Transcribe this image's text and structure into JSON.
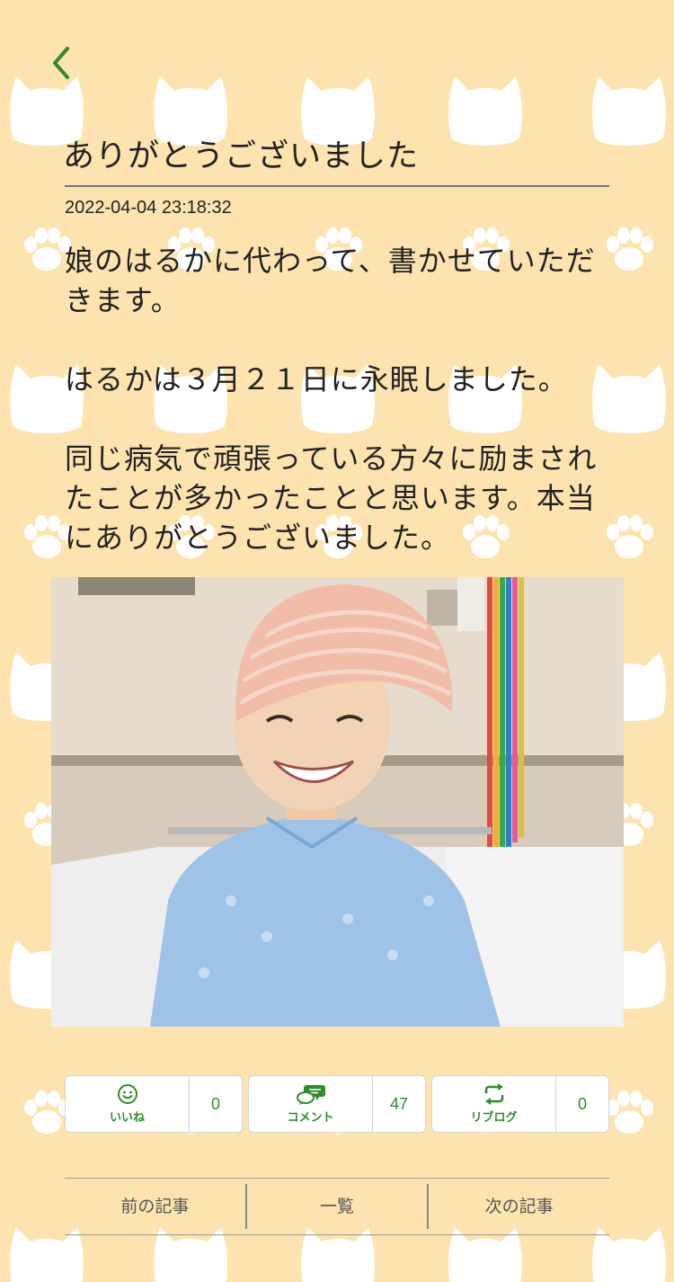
{
  "header": {
    "back_icon": "chevron-left-icon"
  },
  "post": {
    "title": "ありがとうございました",
    "date": "2022-04-04 23:18:32",
    "paragraphs": [
      "娘のはるかに代わって、書かせていただきます。",
      "はるかは３月２１日に永眠しました。",
      "同じ病気で頑張っている方々に励まされたことが多かったことと思います。本当にありがとうございました。"
    ]
  },
  "actions": {
    "like": {
      "label": "いいね",
      "count": "0",
      "icon": "smiley-icon"
    },
    "comment": {
      "label": "コメント",
      "count": "47",
      "icon": "speech-bubbles-icon"
    },
    "reblog": {
      "label": "リブログ",
      "count": "0",
      "icon": "repost-icon"
    }
  },
  "navigation": {
    "prev": "前の記事",
    "list": "一覧",
    "next": "次の記事"
  },
  "colors": {
    "background": "#fde3b0",
    "accent": "#2e8b2e",
    "pattern": "#ffffff"
  }
}
